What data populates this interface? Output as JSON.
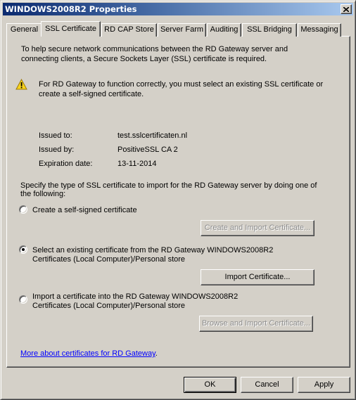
{
  "window": {
    "title": "WINDOWS2008R2 Properties",
    "close_label": "Close"
  },
  "tabs": [
    {
      "label": "General",
      "active": false
    },
    {
      "label": "SSL Certificate",
      "active": true
    },
    {
      "label": "RD CAP Store",
      "active": false
    },
    {
      "label": "Server Farm",
      "active": false
    },
    {
      "label": "Auditing",
      "active": false
    },
    {
      "label": "SSL Bridging",
      "active": false
    },
    {
      "label": "Messaging",
      "active": false
    }
  ],
  "panel": {
    "intro_line1": "To help secure network communications between the RD Gateway server and",
    "intro_line2": "connecting clients, a Secure Sockets Layer (SSL) certificate is required.",
    "warning_icon": "warning-triangle-icon",
    "warning_line1": "For RD Gateway to function correctly, you must select an existing SSL certificate or",
    "warning_line2": "create a self-signed certificate.",
    "certificate": {
      "issued_to_label": "Issued to:",
      "issued_to_value": "test.sslcertificaten.nl",
      "issued_by_label": "Issued by:",
      "issued_by_value": "PositiveSSL CA 2",
      "expiration_label": "Expiration date:",
      "expiration_value": "13-11-2014"
    },
    "specify_line1": "Specify the type of SSL certificate to import for the RD Gateway server by doing one of",
    "specify_line2": "the following:",
    "options": [
      {
        "line1": "Create a self-signed certificate",
        "line2": "",
        "selected": false,
        "button": "Create and Import Certificate...",
        "button_enabled": false
      },
      {
        "line1": "Select an existing certificate from the RD Gateway WINDOWS2008R2",
        "line2": "Certificates (Local Computer)/Personal store",
        "selected": true,
        "button": "Import Certificate...",
        "button_enabled": true
      },
      {
        "line1": "Import a certificate into the RD Gateway WINDOWS2008R2",
        "line2": "Certificates (Local Computer)/Personal store",
        "selected": false,
        "button": "Browse and Import Certificate...",
        "button_enabled": false
      }
    ],
    "more_link": "More about certificates for RD Gateway",
    "more_link_suffix": "."
  },
  "footer": {
    "ok": "OK",
    "cancel": "Cancel",
    "apply": "Apply"
  },
  "colors": {
    "link": "#0000ff",
    "dialog_bg": "#d4d0c8",
    "title_start": "#0b2a6f",
    "title_end": "#a9c9ef",
    "disabled_text": "#8d8d8d"
  }
}
